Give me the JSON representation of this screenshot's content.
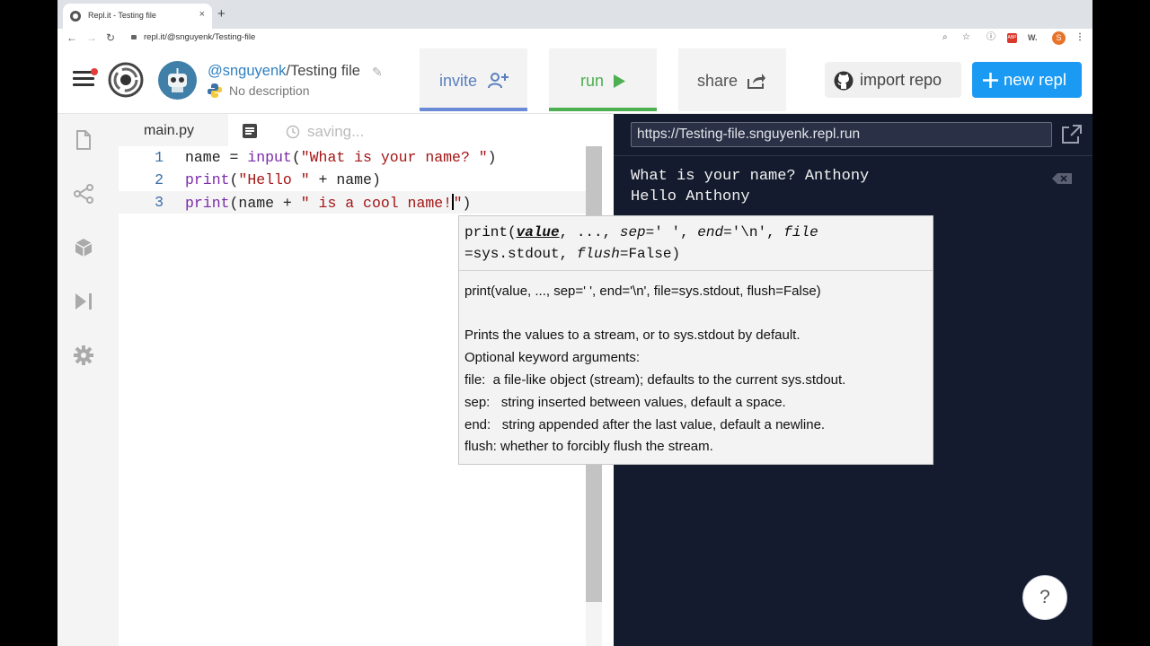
{
  "browser": {
    "tab_title": "Repl.it - Testing file",
    "tab_close": "×",
    "new_tab": "+",
    "back": "←",
    "forward": "→",
    "reload": "↻",
    "url": "repl.it/@snguyenk/Testing-file",
    "profile_initial": "S",
    "ext_abp": "ABP",
    "ext_w": "W."
  },
  "header": {
    "owner": "@snguyenk",
    "repl_name": "Testing file",
    "description": "No description",
    "invite_label": "invite",
    "run_label": "run",
    "share_label": "share",
    "import_label": "import repo",
    "new_repl_label": "new repl"
  },
  "editor": {
    "file_tab": "main.py",
    "status": "saving...",
    "lines": [
      {
        "num": "1",
        "code": "name = input(\"What is your name? \")"
      },
      {
        "num": "2",
        "code": "print(\"Hello \" + name)"
      },
      {
        "num": "3",
        "code": "print(name + \" is a cool name!\")"
      }
    ]
  },
  "tooltip": {
    "signature": "print(value, ..., sep=' ', end='\\n', file=sys.stdout, flush=False)",
    "doc": [
      "print(value, ..., sep=' ', end='\\n', file=sys.stdout, flush=False)",
      "",
      "Prints the values to a stream, or to sys.stdout by default.",
      "Optional keyword arguments:",
      "file:  a file-like object (stream); defaults to the current sys.stdout.",
      "sep:   string inserted between values, default a space.",
      "end:   string appended after the last value, default a newline.",
      "flush: whether to forcibly flush the stream."
    ]
  },
  "console": {
    "url": "https://Testing-file.snguyenk.repl.run",
    "output": [
      "What is your name? Anthony",
      "Hello Anthony"
    ],
    "help_label": "?"
  },
  "colors": {
    "accent_blue": "#1a9af3",
    "run_green": "#4caf50",
    "invite_blue": "#6b8ad6",
    "console_bg": "#141b2e"
  }
}
